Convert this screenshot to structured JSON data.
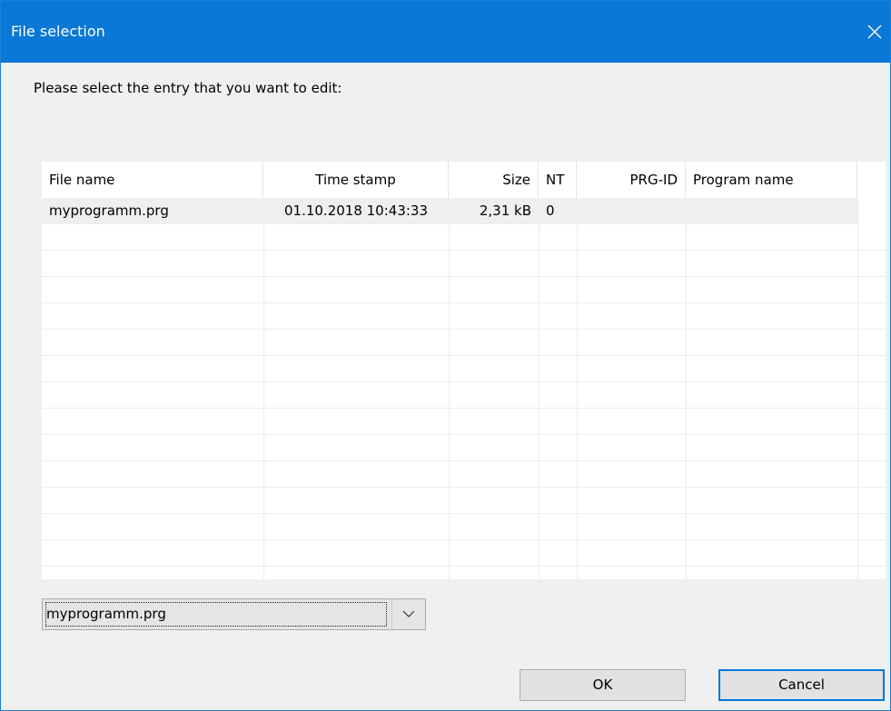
{
  "window": {
    "title": "File selection",
    "close_label": "×"
  },
  "prompt": "Please select the entry that you want to edit:",
  "table": {
    "columns": [
      "File name",
      "Time stamp",
      "Size",
      "NT",
      "PRG-ID",
      "Program name"
    ],
    "rows": [
      {
        "file_name": "myprogramm.prg",
        "time_stamp": "01.10.2018 10:43:33",
        "size": "2,31 kB",
        "nt": "0",
        "prg_id": "",
        "program_name": ""
      }
    ]
  },
  "combo": {
    "value": "myprogramm.prg"
  },
  "buttons": {
    "ok": "OK",
    "cancel": "Cancel"
  },
  "colors": {
    "titlebar": "#0a78d7",
    "default_button_border": "#0078d7"
  }
}
